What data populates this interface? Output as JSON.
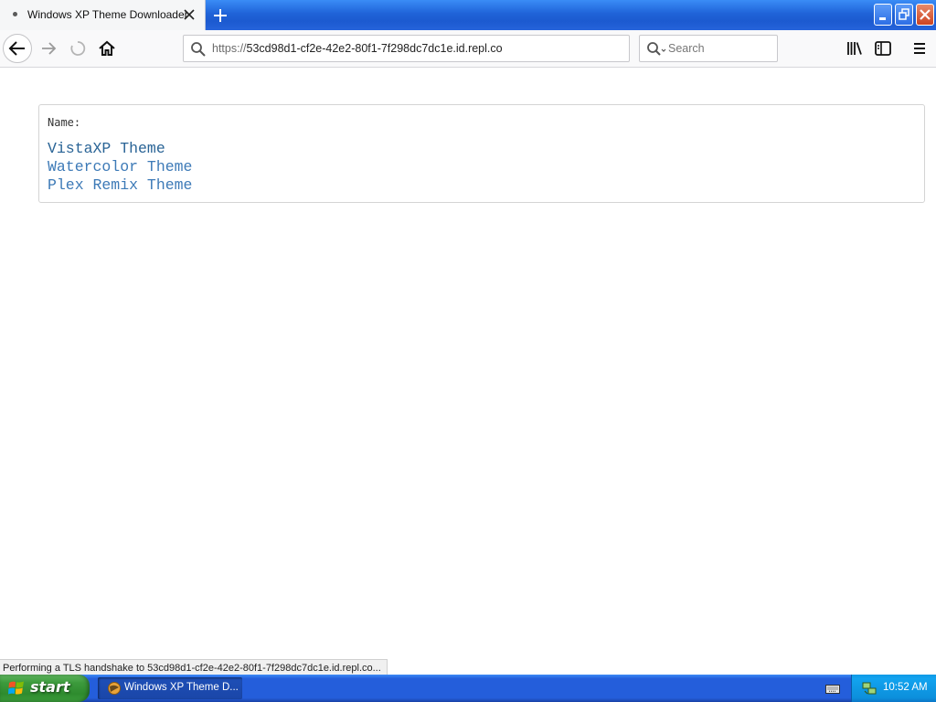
{
  "browser": {
    "tab_title": "Windows XP Theme Downloader",
    "url_prefix": "https://",
    "url_host": "53cd98d1-cf2e-42e2-80f1-7f298dc7dc1e.id.repl.co",
    "search_placeholder": "Search"
  },
  "page": {
    "name_label": "Name:",
    "themes": [
      "VistaXP Theme",
      "Watercolor Theme",
      "Plex Remix Theme"
    ]
  },
  "status_text": "Performing a TLS handshake to 53cd98d1-cf2e-42e2-80f1-7f298dc7dc1e.id.repl.co...",
  "taskbar": {
    "start_label": "start",
    "task_label": "Windows XP Theme D...",
    "clock": "10:52 AM"
  },
  "colors": {
    "link": "#3d7ab7",
    "link_visited": "#2a6496",
    "titlebar": "#2563da",
    "start_green": "#3c9a3c",
    "tray_blue": "#0f9ae6"
  },
  "icons": {
    "tab_close": "close-icon",
    "new_tab": "plus-icon",
    "back": "arrow-left-icon",
    "forward": "arrow-right-icon",
    "reload": "reload-icon",
    "home": "home-icon",
    "url_search": "magnifier-icon",
    "library": "library-icon",
    "sidebar": "sidebar-icon",
    "menu": "hamburger-icon"
  }
}
